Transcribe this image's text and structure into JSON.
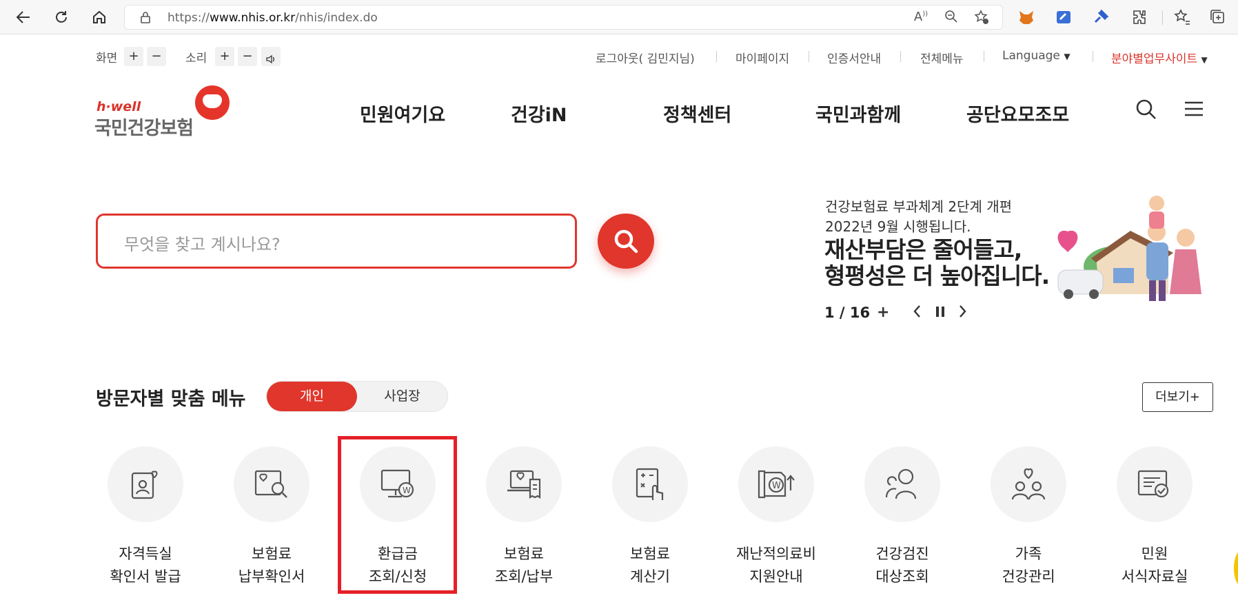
{
  "browser": {
    "url_prefix": "https://",
    "url_domain": "www.nhis.or.kr",
    "url_path": "/nhis/index.do"
  },
  "utility": {
    "screen_label": "화면",
    "sound_label": "소리",
    "plus": "+",
    "minus": "−",
    "logout": "로그아웃( 김민지님)",
    "mypage": "마이페이지",
    "cert": "인증서안내",
    "allmenu": "전체메뉴",
    "language": "Language",
    "field_site": "분야별업무사이트",
    "caret": "▼"
  },
  "logo": {
    "hwell": "h·well",
    "name": "국민건강보험"
  },
  "gnb": [
    "민원여기요",
    "건강iN",
    "정책센터",
    "국민과함께",
    "공단요모조모"
  ],
  "search": {
    "placeholder": "무엇을 찾고 계시나요?"
  },
  "banner": {
    "line1": "건강보험료 부과체계 2단계 개편",
    "line2": "2022년 9월 시행됩니다.",
    "headline1": "재산부담은 줄어들고,",
    "headline2": "형평성은 더 높아집니다.",
    "pager": "1 / 16",
    "plus": "+"
  },
  "section": {
    "title": "방문자별 맞춤 메뉴",
    "tab_personal": "개인",
    "tab_business": "사업장",
    "more": "더보기+"
  },
  "quick_menu": [
    {
      "l1": "자격득실",
      "l2": "확인서 발급",
      "icon": "id-card-heart-icon"
    },
    {
      "l1": "보험료",
      "l2": "납부확인서",
      "icon": "document-search-icon"
    },
    {
      "l1": "환급금",
      "l2": "조회/신청",
      "icon": "monitor-won-icon"
    },
    {
      "l1": "보험료",
      "l2": "조회/납부",
      "icon": "laptop-receipt-icon"
    },
    {
      "l1": "보험료",
      "l2": "계산기",
      "icon": "calculator-hand-icon"
    },
    {
      "l1": "재난적의료비",
      "l2": "지원안내",
      "icon": "won-up-icon"
    },
    {
      "l1": "건강검진",
      "l2": "대상조회",
      "icon": "people-search-icon"
    },
    {
      "l1": "가족",
      "l2": "건강관리",
      "icon": "family-heart-icon"
    },
    {
      "l1": "민원",
      "l2": "서식자료실",
      "icon": "form-check-icon"
    }
  ],
  "colors": {
    "accent": "#e0362c",
    "highlight": "#e51f28"
  }
}
